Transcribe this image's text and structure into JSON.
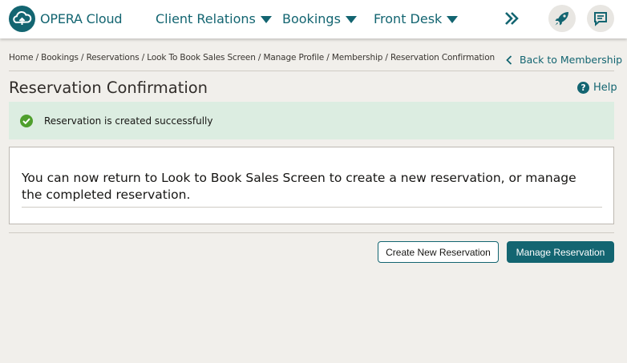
{
  "header": {
    "brand": "OPERA Cloud",
    "logo_icon": "cloud-logo-icon",
    "menus": [
      {
        "label": "Client Relations"
      },
      {
        "label": "Bookings"
      },
      {
        "label": "Front Desk"
      }
    ],
    "more_icon": "double-chevron-right-icon",
    "actions": [
      "rocket-icon",
      "chat-icon"
    ]
  },
  "breadcrumb": "Home / Bookings / Reservations / Look To Book Sales Screen / Manage Profile / Membership / Reservation Confirmation",
  "back_link": "Back to Membership",
  "page_title": "Reservation Confirmation",
  "help_label": "Help",
  "success_message": "Reservation is created successfully",
  "info_text": "You can now return to Look to Book Sales Screen to create a new reservation, or manage the completed reservation.",
  "buttons": {
    "create": "Create New Reservation",
    "manage": "Manage Reservation"
  },
  "colors": {
    "accent": "#136571",
    "success_bg": "#dcede1",
    "success_icon": "#4f9f2d",
    "page_bg": "#f1efeb"
  }
}
